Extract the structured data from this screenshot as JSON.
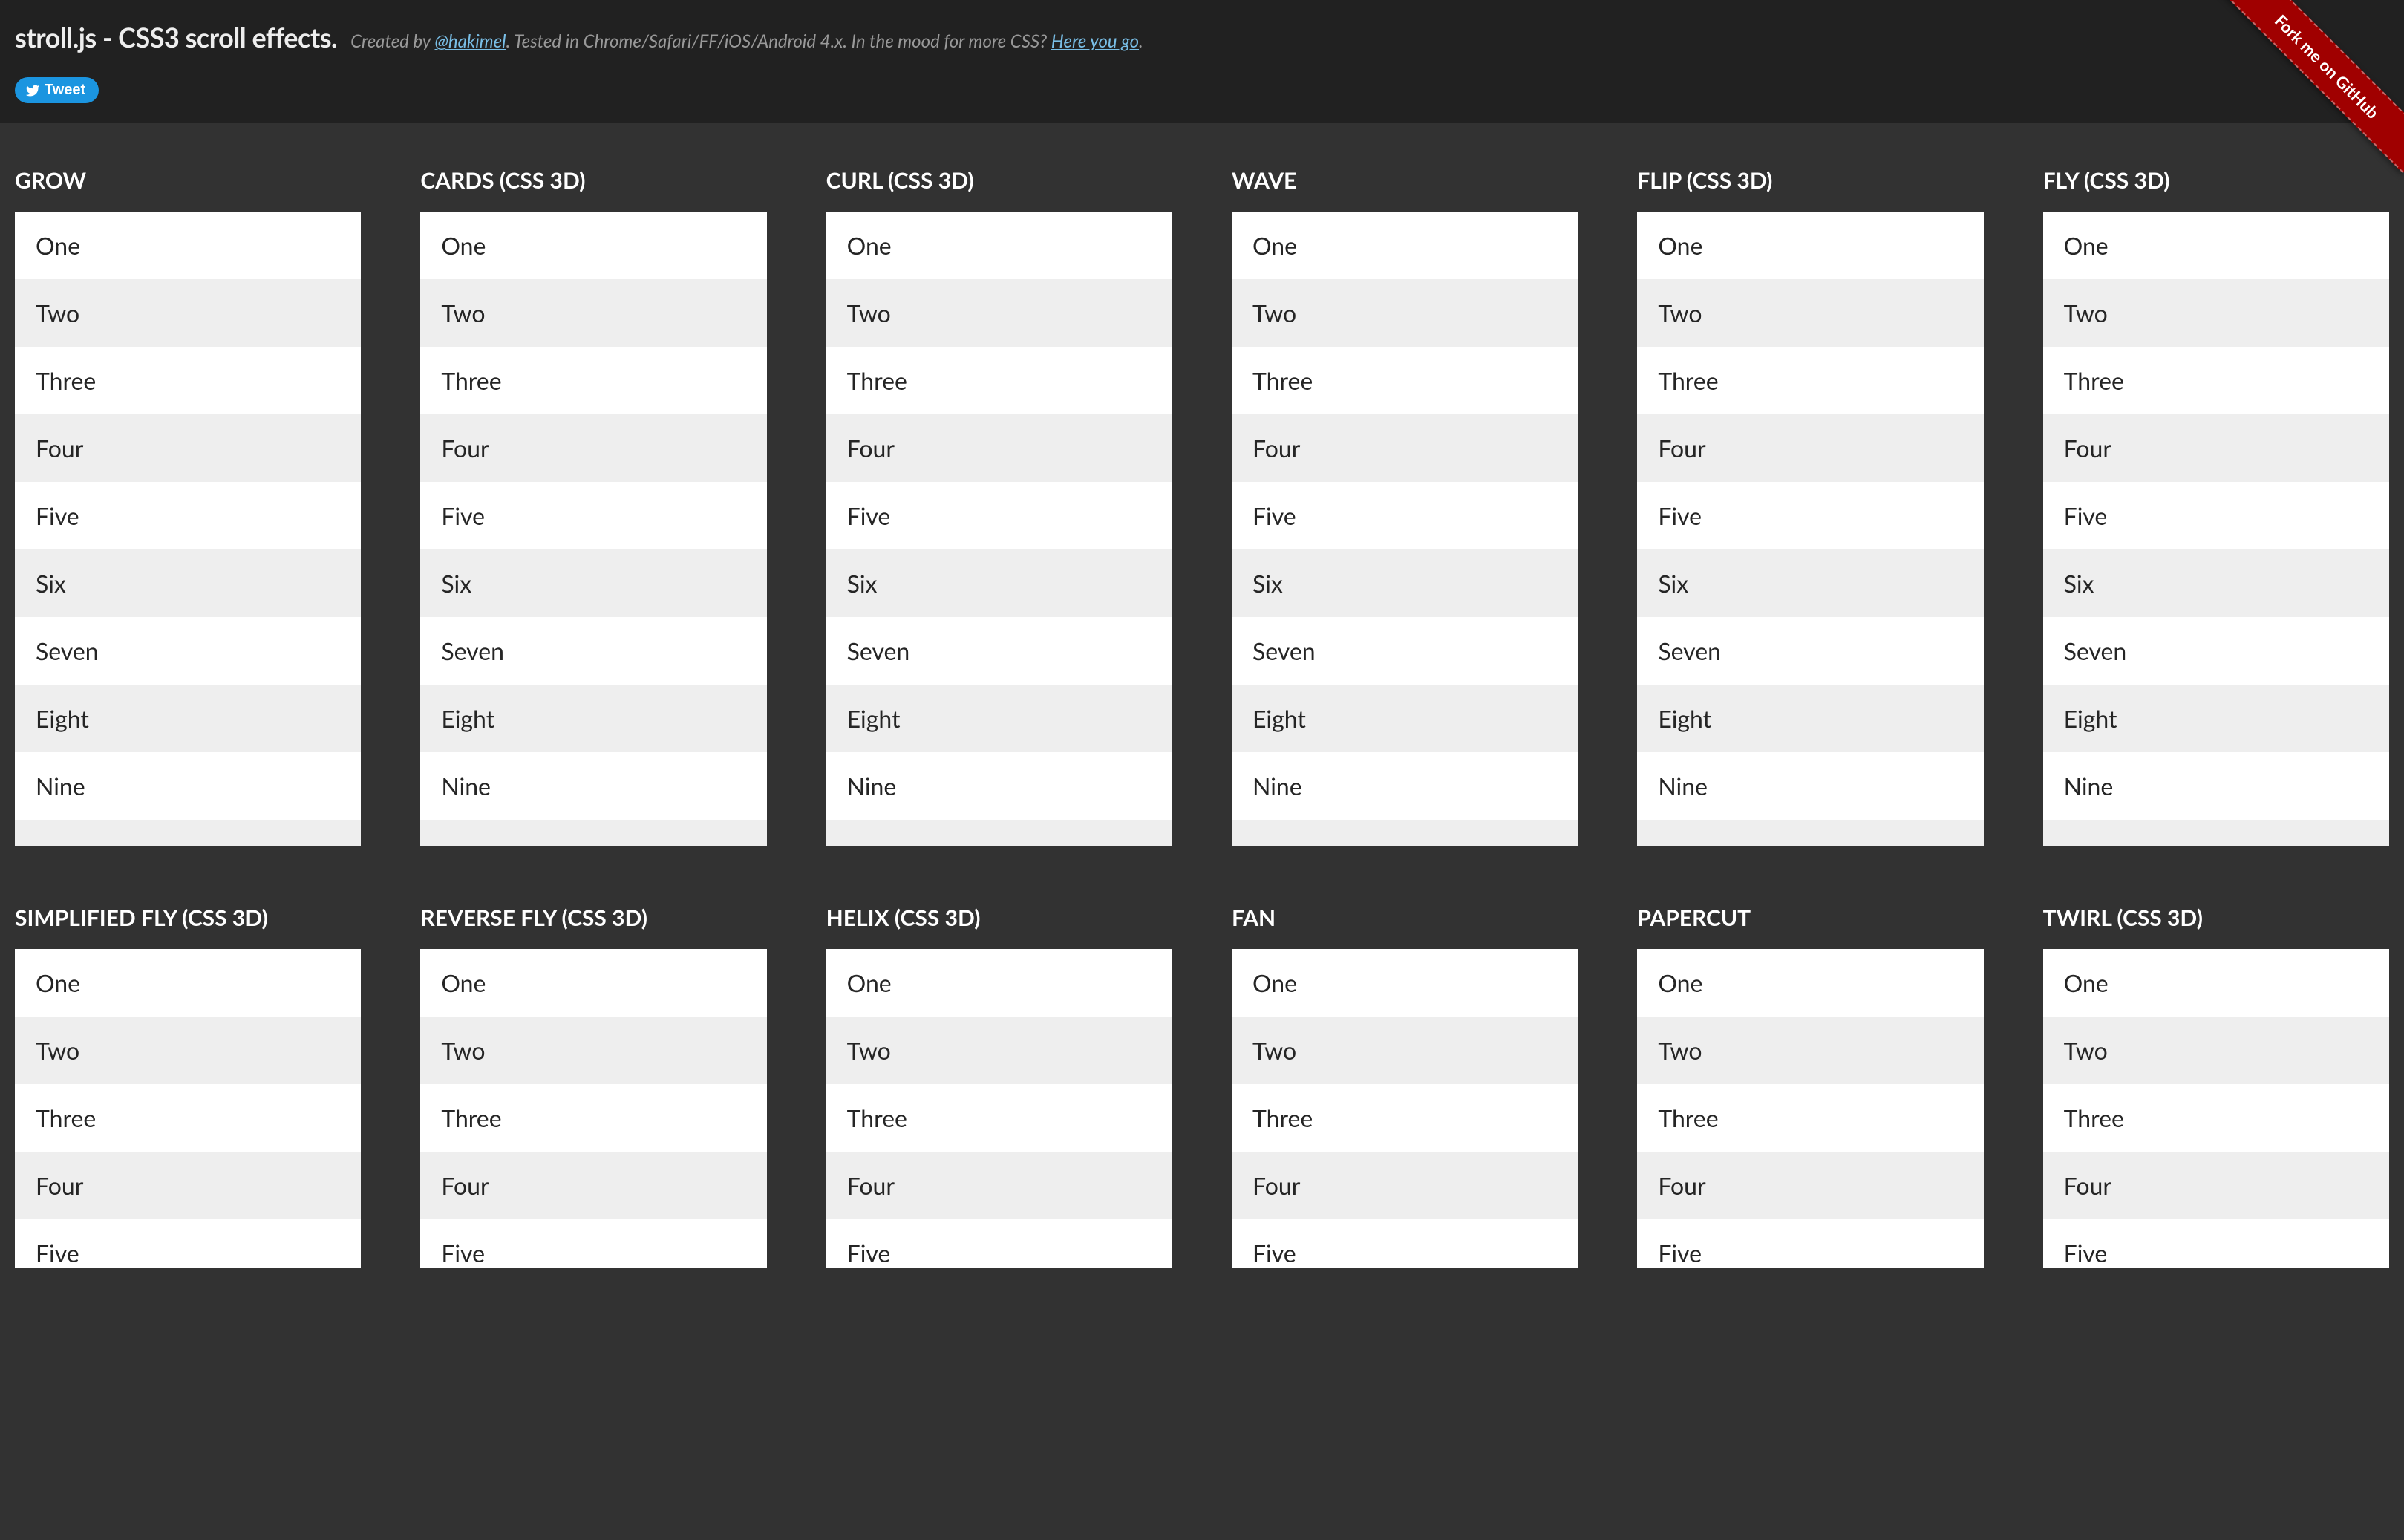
{
  "header": {
    "title": "stroll.js - CSS3 scroll effects.",
    "subtitle_prefix": "Created by ",
    "author_link": "@hakimel",
    "subtitle_mid": ". Tested in Chrome/Safari/FF/iOS/Android 4.x. In the mood for more CSS? ",
    "more_link": "Here you go",
    "subtitle_suffix": ".",
    "tweet_label": "Tweet",
    "fork_label": "Fork me on GitHub"
  },
  "items": [
    "One",
    "Two",
    "Three",
    "Four",
    "Five",
    "Six",
    "Seven",
    "Eight",
    "Nine",
    "Ten"
  ],
  "demos_row1": [
    {
      "title": "GROW"
    },
    {
      "title": "CARDS (CSS 3D)"
    },
    {
      "title": "CURL (CSS 3D)"
    },
    {
      "title": "WAVE"
    },
    {
      "title": "FLIP (CSS 3D)"
    },
    {
      "title": "FLY (CSS 3D)"
    }
  ],
  "demos_row2": [
    {
      "title": "SIMPLIFIED FLY (CSS 3D)"
    },
    {
      "title": "REVERSE FLY (CSS 3D)"
    },
    {
      "title": "HELIX (CSS 3D)"
    },
    {
      "title": "FAN"
    },
    {
      "title": "PAPERCUT"
    },
    {
      "title": "TWIRL (CSS 3D)"
    }
  ]
}
